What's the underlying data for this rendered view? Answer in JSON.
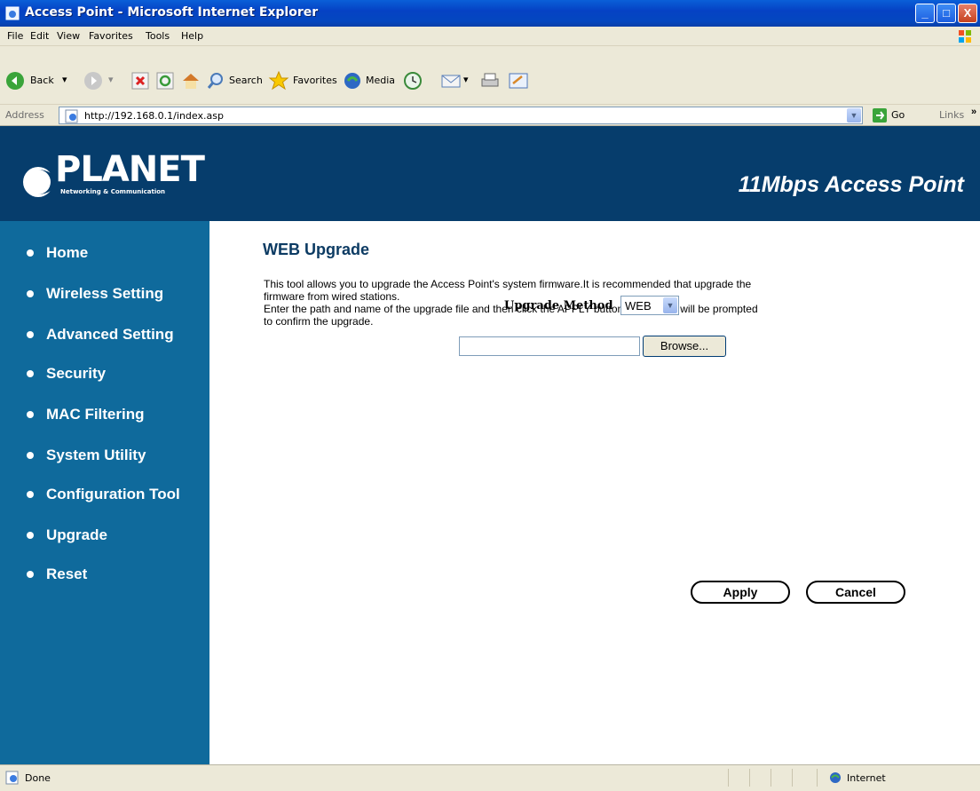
{
  "window": {
    "title": "Access Point - Microsoft Internet Explorer",
    "controls": [
      "_",
      "□",
      "X"
    ]
  },
  "menubar": {
    "items": [
      "File",
      "Edit",
      "View",
      "Favorites",
      "Tools",
      "Help"
    ]
  },
  "toolbar": {
    "back_label": "Back",
    "search_label": "Search",
    "favorites_label": "Favorites",
    "media_label": "Media"
  },
  "address": {
    "label": "Address",
    "url": "http://192.168.0.1/index.asp",
    "go_label": "Go",
    "links_label": "Links"
  },
  "banner": {
    "logo": "PLANET",
    "logo_sub": "Networking & Communication",
    "product": "11Mbps Access Point"
  },
  "sidebar": {
    "items": [
      {
        "label": "Home"
      },
      {
        "label": "Wireless Setting"
      },
      {
        "label": "Advanced Setting"
      },
      {
        "label": "Security"
      },
      {
        "label": "MAC Filtering"
      },
      {
        "label": "System Utility"
      },
      {
        "label": "Configuration Tool"
      },
      {
        "label": "Upgrade"
      },
      {
        "label": "Reset"
      }
    ]
  },
  "main": {
    "heading": "WEB Upgrade",
    "para1_line1": "This tool allows you to upgrade the Access Point's system firmware.It is recommended that upgrade the",
    "para1_line2": "firmware from wired stations.",
    "para2_line1": "Enter the path and name of the upgrade file and then click the APPLY button below. You will be prompted",
    "para2_line2": "to confirm the upgrade.",
    "upgrade_method_label": "Upgrade Method",
    "upgrade_method_value": "WEB",
    "file_path": "",
    "browse_label": "Browse...",
    "apply_label": "Apply",
    "cancel_label": "Cancel"
  },
  "status": {
    "text": "Done",
    "zone": "Internet"
  }
}
